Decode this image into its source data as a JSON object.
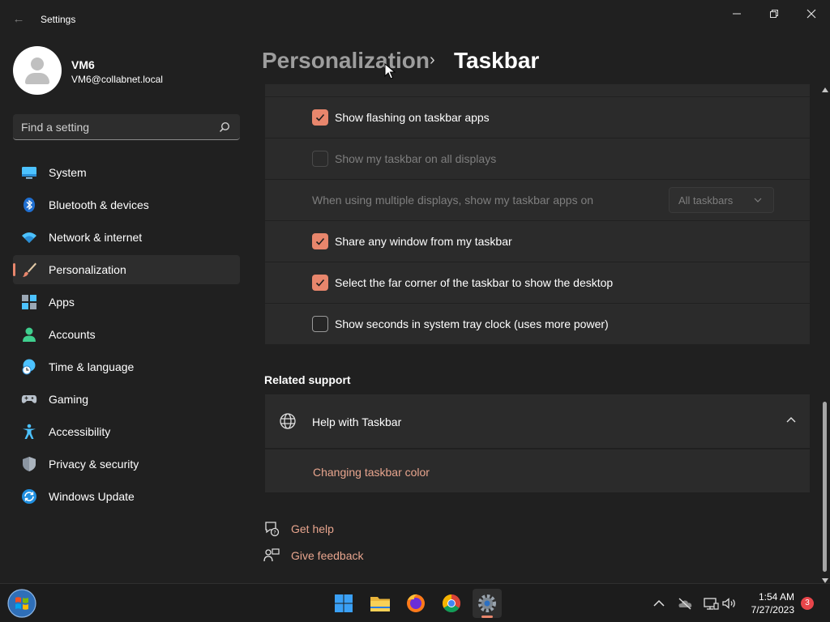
{
  "window": {
    "title": "Settings",
    "back_icon": "back-arrow-icon",
    "controls": [
      "minimize-icon",
      "maximize-icon",
      "close-icon"
    ]
  },
  "user": {
    "name": "VM6",
    "email": "VM6@collabnet.local"
  },
  "search": {
    "placeholder": "Find a setting",
    "value": ""
  },
  "sidebar": {
    "items": [
      {
        "label": "System",
        "icon": "monitor-icon",
        "active": false
      },
      {
        "label": "Bluetooth & devices",
        "icon": "bluetooth-icon",
        "active": false
      },
      {
        "label": "Network & internet",
        "icon": "wifi-icon",
        "active": false
      },
      {
        "label": "Personalization",
        "icon": "brush-icon",
        "active": true
      },
      {
        "label": "Apps",
        "icon": "apps-icon",
        "active": false
      },
      {
        "label": "Accounts",
        "icon": "person-icon",
        "active": false
      },
      {
        "label": "Time & language",
        "icon": "globe-clock-icon",
        "active": false
      },
      {
        "label": "Gaming",
        "icon": "gamepad-icon",
        "active": false
      },
      {
        "label": "Accessibility",
        "icon": "accessibility-icon",
        "active": false
      },
      {
        "label": "Privacy & security",
        "icon": "shield-icon",
        "active": false
      },
      {
        "label": "Windows Update",
        "icon": "update-icon",
        "active": false
      }
    ]
  },
  "header": {
    "parent": "Personalization",
    "separator": "›",
    "current": "Taskbar"
  },
  "settings": {
    "flashing": {
      "label": "Show flashing on taskbar apps",
      "checked": true,
      "enabled": true
    },
    "all_displays": {
      "label": "Show my taskbar on all displays",
      "checked": false,
      "enabled": false
    },
    "multi_display": {
      "label": "When using multiple displays, show my taskbar apps on",
      "value": "All taskbars",
      "enabled": false
    },
    "share_window": {
      "label": "Share any window from my taskbar",
      "checked": true,
      "enabled": true
    },
    "far_corner": {
      "label": "Select the far corner of the taskbar to show the desktop",
      "checked": true,
      "enabled": true
    },
    "seconds": {
      "label": "Show seconds in system tray clock (uses more power)",
      "checked": false,
      "enabled": true
    }
  },
  "related": {
    "title": "Related support",
    "card_title": "Help with Taskbar",
    "card_expanded": true,
    "link": "Changing taskbar color"
  },
  "footer": {
    "get_help": "Get help",
    "give_feedback": "Give feedback"
  },
  "taskbar": {
    "apps": [
      "windows-start-icon",
      "file-explorer-icon",
      "firefox-icon",
      "chrome-icon",
      "settings-gear-icon"
    ],
    "time": "1:54 AM",
    "date": "7/27/2023",
    "notification_count": "3"
  },
  "colors": {
    "accent": "#e8866c",
    "link": "#e8a58e",
    "background": "#202020",
    "card": "#2b2b2b"
  }
}
